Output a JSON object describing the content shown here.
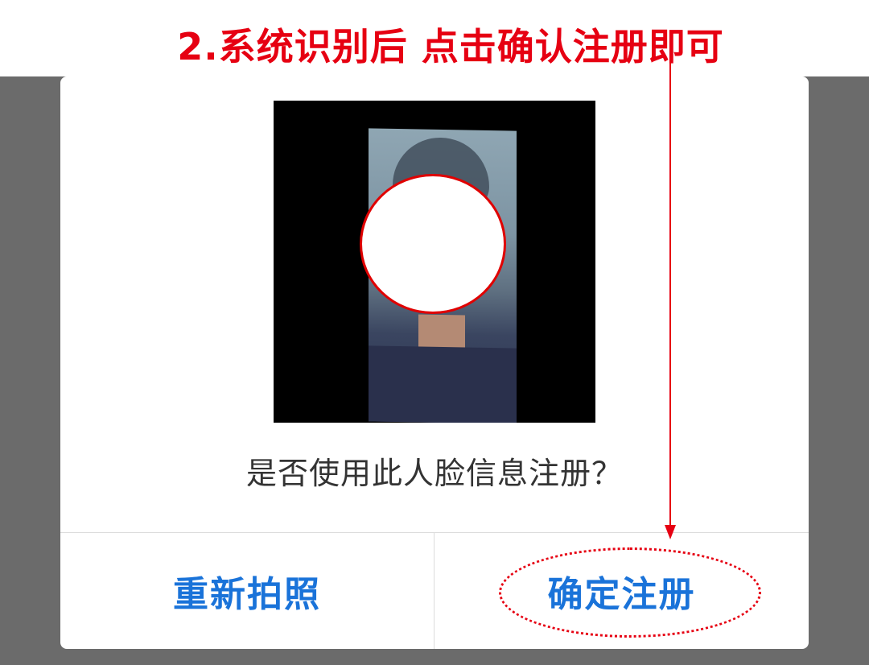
{
  "annotation": {
    "text": "2.系统识别后 点击确认注册即可",
    "color": "#e60012"
  },
  "dialog": {
    "question": "是否使用此人脸信息注册？",
    "buttons": {
      "retake_label": "重新拍照",
      "confirm_label": "确定注册"
    },
    "button_color": "#1a73d9"
  },
  "backdrop_color": "#6b6b6b"
}
